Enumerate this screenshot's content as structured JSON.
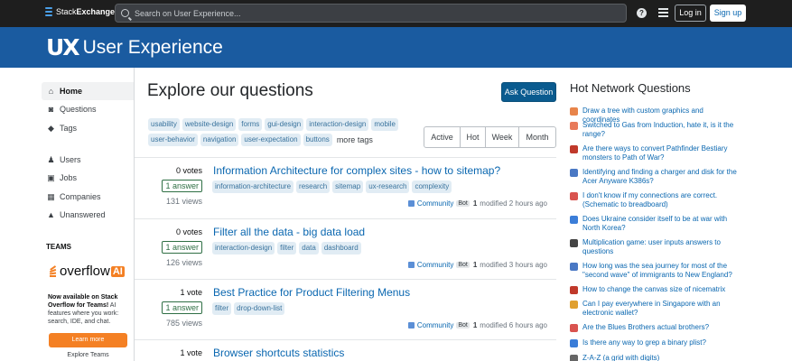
{
  "topbar": {
    "brand_light": "Stack",
    "brand_bold": "Exchange",
    "search_placeholder": "Search on User Experience...",
    "help_label": "?",
    "login_label": "Log in",
    "signup_label": "Sign up"
  },
  "banner": {
    "site_mark": "UX",
    "site_name": "User Experience"
  },
  "sidebar": {
    "items": [
      {
        "label": "Home",
        "icon": "home-icon",
        "glyph": "⌂"
      },
      {
        "label": "Questions",
        "icon": "questions-icon",
        "glyph": "◙"
      },
      {
        "label": "Tags",
        "icon": "tag-icon",
        "glyph": "◆"
      },
      {
        "label": "Users",
        "icon": "users-icon",
        "glyph": "♟"
      },
      {
        "label": "Jobs",
        "icon": "jobs-icon",
        "glyph": "▣"
      },
      {
        "label": "Companies",
        "icon": "companies-icon",
        "glyph": "▦"
      },
      {
        "label": "Unanswered",
        "icon": "unanswered-icon",
        "glyph": "▲"
      }
    ],
    "teams_heading": "TEAMS",
    "teams_logo_text": "overflow",
    "teams_logo_badge": "AI",
    "teams_text_bold": "Now available on Stack Overflow for Teams!",
    "teams_text": " AI features where you work: search, IDE, and chat.",
    "learn_more_label": "Learn more",
    "explore_teams_label": "Explore Teams"
  },
  "main": {
    "title": "Explore our questions",
    "ask_label": "Ask Question",
    "popular_tags_row1": [
      "usability",
      "website-design",
      "forms",
      "gui-design",
      "interaction-design",
      "mobile"
    ],
    "popular_tags_row2": [
      "user-behavior",
      "navigation",
      "user-expectation",
      "buttons"
    ],
    "more_tags_label": "more tags",
    "filters": [
      "Active",
      "Hot",
      "Week",
      "Month"
    ],
    "questions": [
      {
        "votes": "0 votes",
        "answers": "1 answer",
        "views": "131 views",
        "title": "Information Architecture for complex sites - how to sitemap?",
        "tags": [
          "information-architecture",
          "research",
          "sitemap",
          "ux-research",
          "complexity"
        ],
        "user": "Community",
        "bot": "Bot",
        "rep": "1",
        "time": "modified 2 hours ago"
      },
      {
        "votes": "0 votes",
        "answers": "1 answer",
        "views": "126 views",
        "title": "Filter all the data - big data load",
        "tags": [
          "interaction-design",
          "filter",
          "data",
          "dashboard"
        ],
        "user": "Community",
        "bot": "Bot",
        "rep": "1",
        "time": "modified 3 hours ago"
      },
      {
        "votes": "1 vote",
        "answers": "1 answer",
        "views": "785 views",
        "title": "Best Practice for Product Filtering Menus",
        "tags": [
          "filter",
          "drop-down-list"
        ],
        "user": "Community",
        "bot": "Bot",
        "rep": "1",
        "time": "modified 6 hours ago"
      },
      {
        "votes": "1 vote",
        "title": "Browser shortcuts statistics"
      }
    ]
  },
  "hot_network": {
    "title": "Hot Network Questions",
    "items": [
      {
        "text": "Draw a tree with custom graphics and coordinates",
        "color": "#e8844a"
      },
      {
        "text": "Switched to Gas from Induction, hate it, is it the range?",
        "color": "#e87a5a"
      },
      {
        "text": "Are there ways to convert Pathfinder Bestiary monsters to Path of War?",
        "color": "#c0392b"
      },
      {
        "text": "Identifying and finding a charger and disk for the Acer Anyware K386s?",
        "color": "#4a78c4"
      },
      {
        "text": "I don't know if my connections are correct. (Schematic to breadboard)",
        "color": "#d9534f"
      },
      {
        "text": "Does Ukraine consider itself to be at war with North Korea?",
        "color": "#3b7dd8"
      },
      {
        "text": "Multiplication game: user inputs answers to questions",
        "color": "#444444"
      },
      {
        "text": "How long was the sea journey for most of the \"second wave\" of immigrants to New England?",
        "color": "#4a78c4"
      },
      {
        "text": "How to change the canvas size of nicematrix",
        "color": "#c0392b"
      },
      {
        "text": "Can I pay everywhere in Singapore with an electronic wallet?",
        "color": "#e0a030"
      },
      {
        "text": "Are the Blues Brothers actual brothers?",
        "color": "#d9534f"
      },
      {
        "text": "Is there any way to grep a binary plist?",
        "color": "#3b7dd8"
      },
      {
        "text": "Z-A-Z (a grid with digits)",
        "color": "#666666"
      }
    ]
  }
}
